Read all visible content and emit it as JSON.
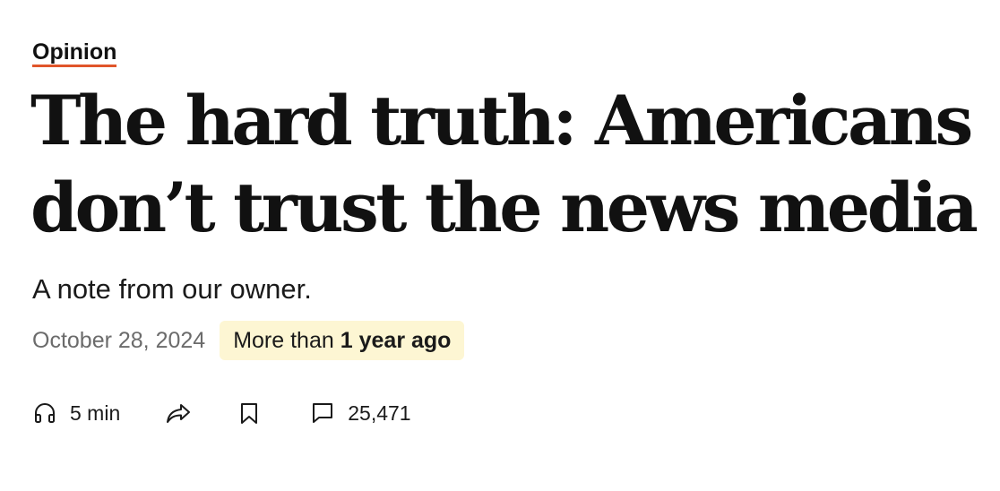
{
  "article": {
    "section_label": "Opinion",
    "headline": "The hard truth: Americans don’t trust the news media",
    "subheadline": "A note from our owner.",
    "published_date": "October 28, 2024",
    "age_badge": {
      "prefix": "More than",
      "emphasis": "1 year ago",
      "background_color": "#fdf6d3"
    },
    "accent_color": "#e0552a"
  },
  "actions": {
    "listen": {
      "icon": "headphones-icon",
      "label": "5 min"
    },
    "share": {
      "icon": "share-arrow-icon"
    },
    "save": {
      "icon": "bookmark-icon"
    },
    "comments": {
      "icon": "comment-bubble-icon",
      "count": "25,471"
    }
  }
}
